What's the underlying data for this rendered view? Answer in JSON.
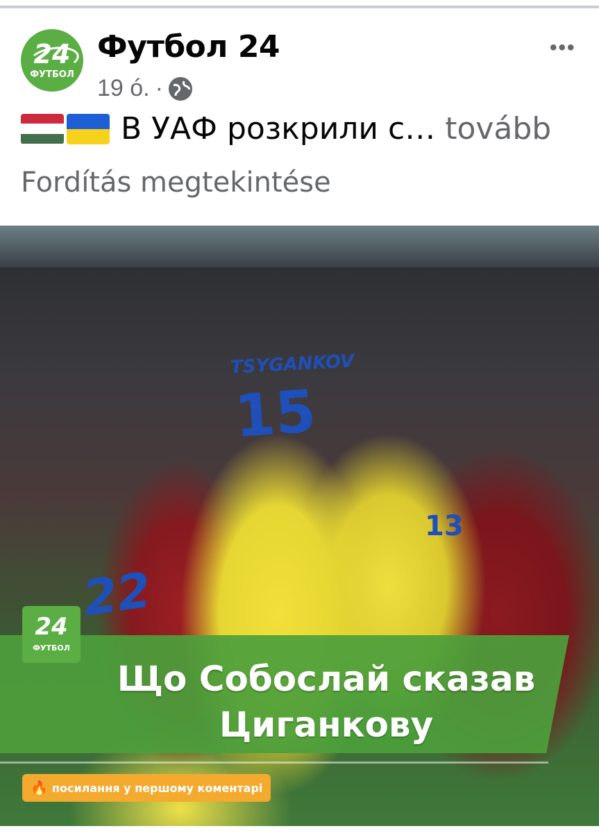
{
  "post": {
    "page_name": "Футбол 24",
    "time": "19 ó.",
    "separator": "·",
    "caption_text": "В УАФ розкрили с…",
    "see_more": "tovább",
    "translate_link": "Fordítás megtekintése",
    "avatar": {
      "number": "24",
      "label": "ФУТБОЛ"
    }
  },
  "image": {
    "jersey_name": "TSYGANKOV",
    "number_15": "15",
    "number_13": "13",
    "number_22": "22",
    "logo": {
      "number": "24",
      "label": "ФУТБОЛ"
    },
    "headline": "Що Собослай сказав Циганкову",
    "link_note": "посилання у першому коментарі"
  },
  "icons": {
    "globe": "globe-icon",
    "more": "more-options-icon",
    "fire": "fire-icon"
  },
  "colors": {
    "brand_green": "#5aae44",
    "banner_green": "#4ca03c",
    "pill_orange": "#f4a92f",
    "meta_gray": "#65676b"
  }
}
